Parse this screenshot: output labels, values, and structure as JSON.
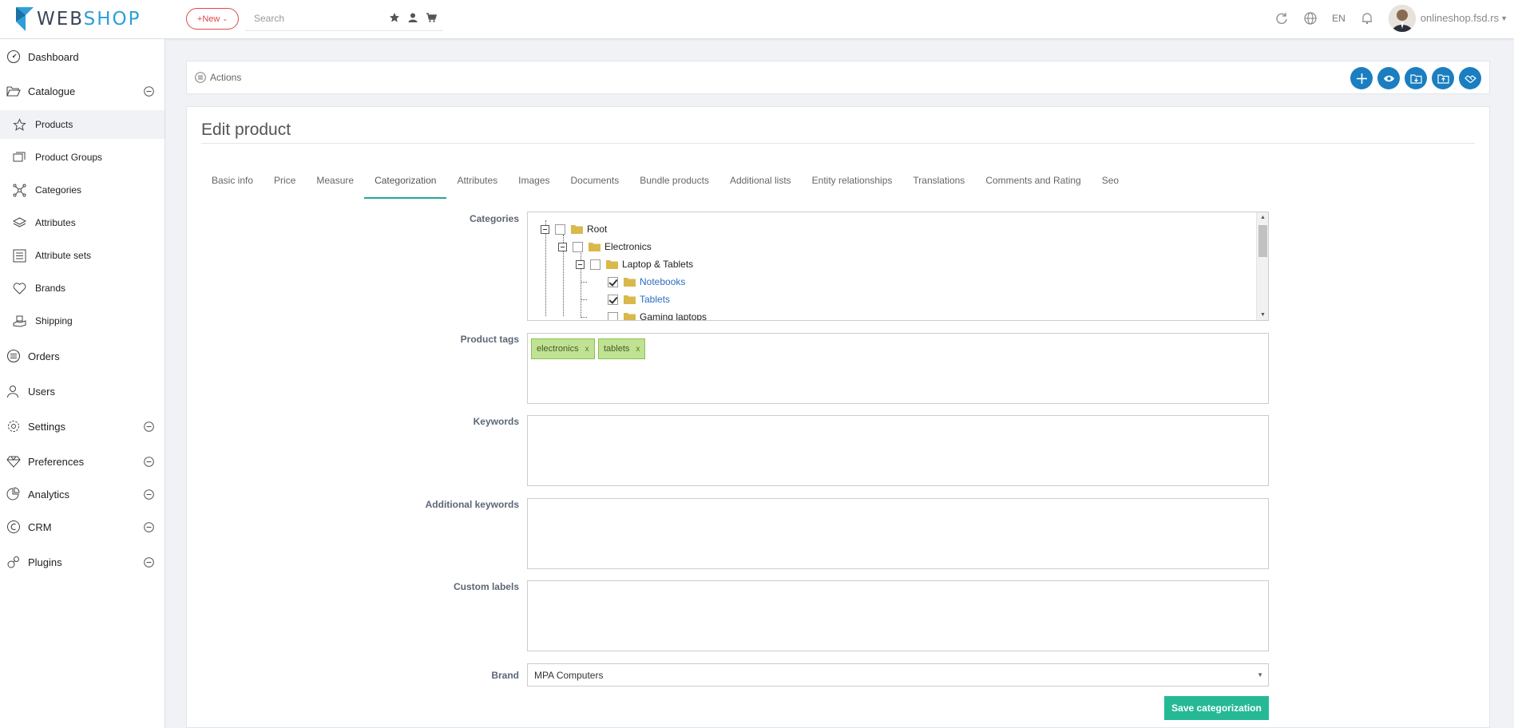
{
  "app": {
    "logo_part1": "WEB",
    "logo_part2": "SHOP",
    "new_button": "+New",
    "search_placeholder": "Search",
    "language": "EN",
    "shop_name": "onlineshop.fsd.rs"
  },
  "sidebar": {
    "items": [
      {
        "label": "Dashboard",
        "icon": "dashboard-icon"
      },
      {
        "label": "Catalogue",
        "icon": "folder-open-icon",
        "expanded": true
      },
      {
        "label": "Products",
        "icon": "star-icon",
        "sub": true,
        "active": true
      },
      {
        "label": "Product Groups",
        "icon": "groups-icon",
        "sub": true
      },
      {
        "label": "Categories",
        "icon": "network-icon",
        "sub": true
      },
      {
        "label": "Attributes",
        "icon": "layers-icon",
        "sub": true
      },
      {
        "label": "Attribute sets",
        "icon": "list-icon",
        "sub": true
      },
      {
        "label": "Brands",
        "icon": "heart-icon",
        "sub": true
      },
      {
        "label": "Shipping",
        "icon": "shipping-icon",
        "sub": true
      },
      {
        "label": "Orders",
        "icon": "orders-icon"
      },
      {
        "label": "Users",
        "icon": "users-icon"
      },
      {
        "label": "Settings",
        "icon": "gear-icon"
      },
      {
        "label": "Preferences",
        "icon": "diamond-icon"
      },
      {
        "label": "Analytics",
        "icon": "pie-chart-icon"
      },
      {
        "label": "CRM",
        "icon": "crm-icon"
      },
      {
        "label": "Plugins",
        "icon": "plugin-icon"
      }
    ]
  },
  "actions": {
    "label": "Actions"
  },
  "page": {
    "title": "Edit product",
    "tabs": [
      {
        "label": "Basic info"
      },
      {
        "label": "Price"
      },
      {
        "label": "Measure"
      },
      {
        "label": "Categorization",
        "active": true
      },
      {
        "label": "Attributes"
      },
      {
        "label": "Images"
      },
      {
        "label": "Documents"
      },
      {
        "label": "Bundle products"
      },
      {
        "label": "Additional lists"
      },
      {
        "label": "Entity relationships"
      },
      {
        "label": "Translations"
      },
      {
        "label": "Comments and Rating"
      },
      {
        "label": "Seo"
      }
    ]
  },
  "form": {
    "categories_label": "Categories",
    "tree": [
      {
        "label": "Root",
        "checked": false
      },
      {
        "label": "Electronics",
        "checked": false
      },
      {
        "label": "Laptop & Tablets",
        "checked": false
      },
      {
        "label": "Notebooks",
        "checked": true
      },
      {
        "label": "Tablets",
        "checked": true
      },
      {
        "label": "Gaming laptops",
        "checked": false
      }
    ],
    "tags_label": "Product tags",
    "tags": [
      "electronics",
      "tablets"
    ],
    "tag_remove": "x",
    "keywords_label": "Keywords",
    "additional_keywords_label": "Additional keywords",
    "custom_labels_label": "Custom labels",
    "brand_label": "Brand",
    "brand_value": "MPA Computers",
    "save_button": "Save categorization"
  },
  "colors": {
    "accent": "#1a7ec0",
    "save": "#26b996",
    "tab_active": "#26a69a",
    "tag_bg": "#bfe293"
  }
}
